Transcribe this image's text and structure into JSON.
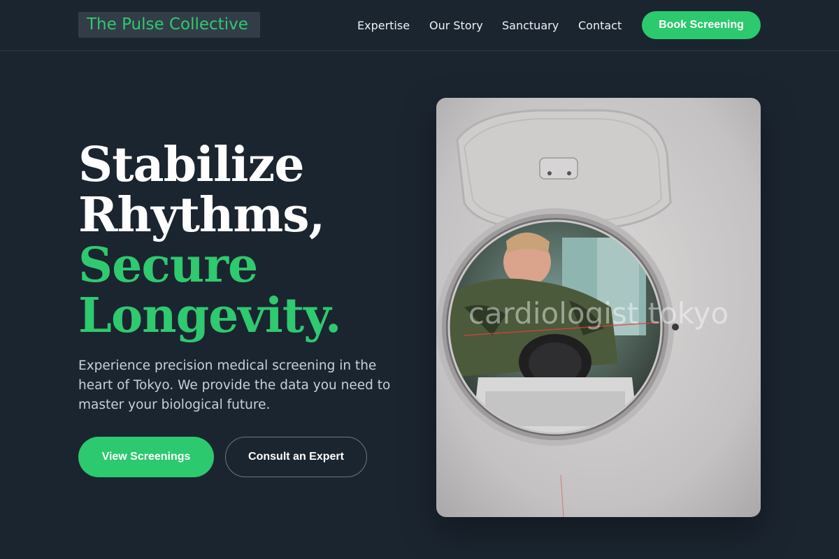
{
  "brand": {
    "name": "The Pulse Collective"
  },
  "nav": {
    "links": [
      "Expertise",
      "Our Story",
      "Sanctuary",
      "Contact"
    ],
    "cta": "Book Screening"
  },
  "hero": {
    "headline_white": [
      "Stabilize",
      "Rhythms,"
    ],
    "headline_green": [
      "Secure",
      "Longevity."
    ],
    "lead": "Experience precision medical screening in the heart of Tokyo. We provide the data you need to master your biological future.",
    "primary_button": "View Screenings",
    "secondary_button": "Consult an Expert",
    "image_watermark": "cardiologist tokyo",
    "image_alt": "Patient entering a medical scanner"
  },
  "colors": {
    "background": "#1b2530",
    "accent": "#2cc96e",
    "logo_bg": "#323d48",
    "text_muted": "#c8d0d8"
  }
}
